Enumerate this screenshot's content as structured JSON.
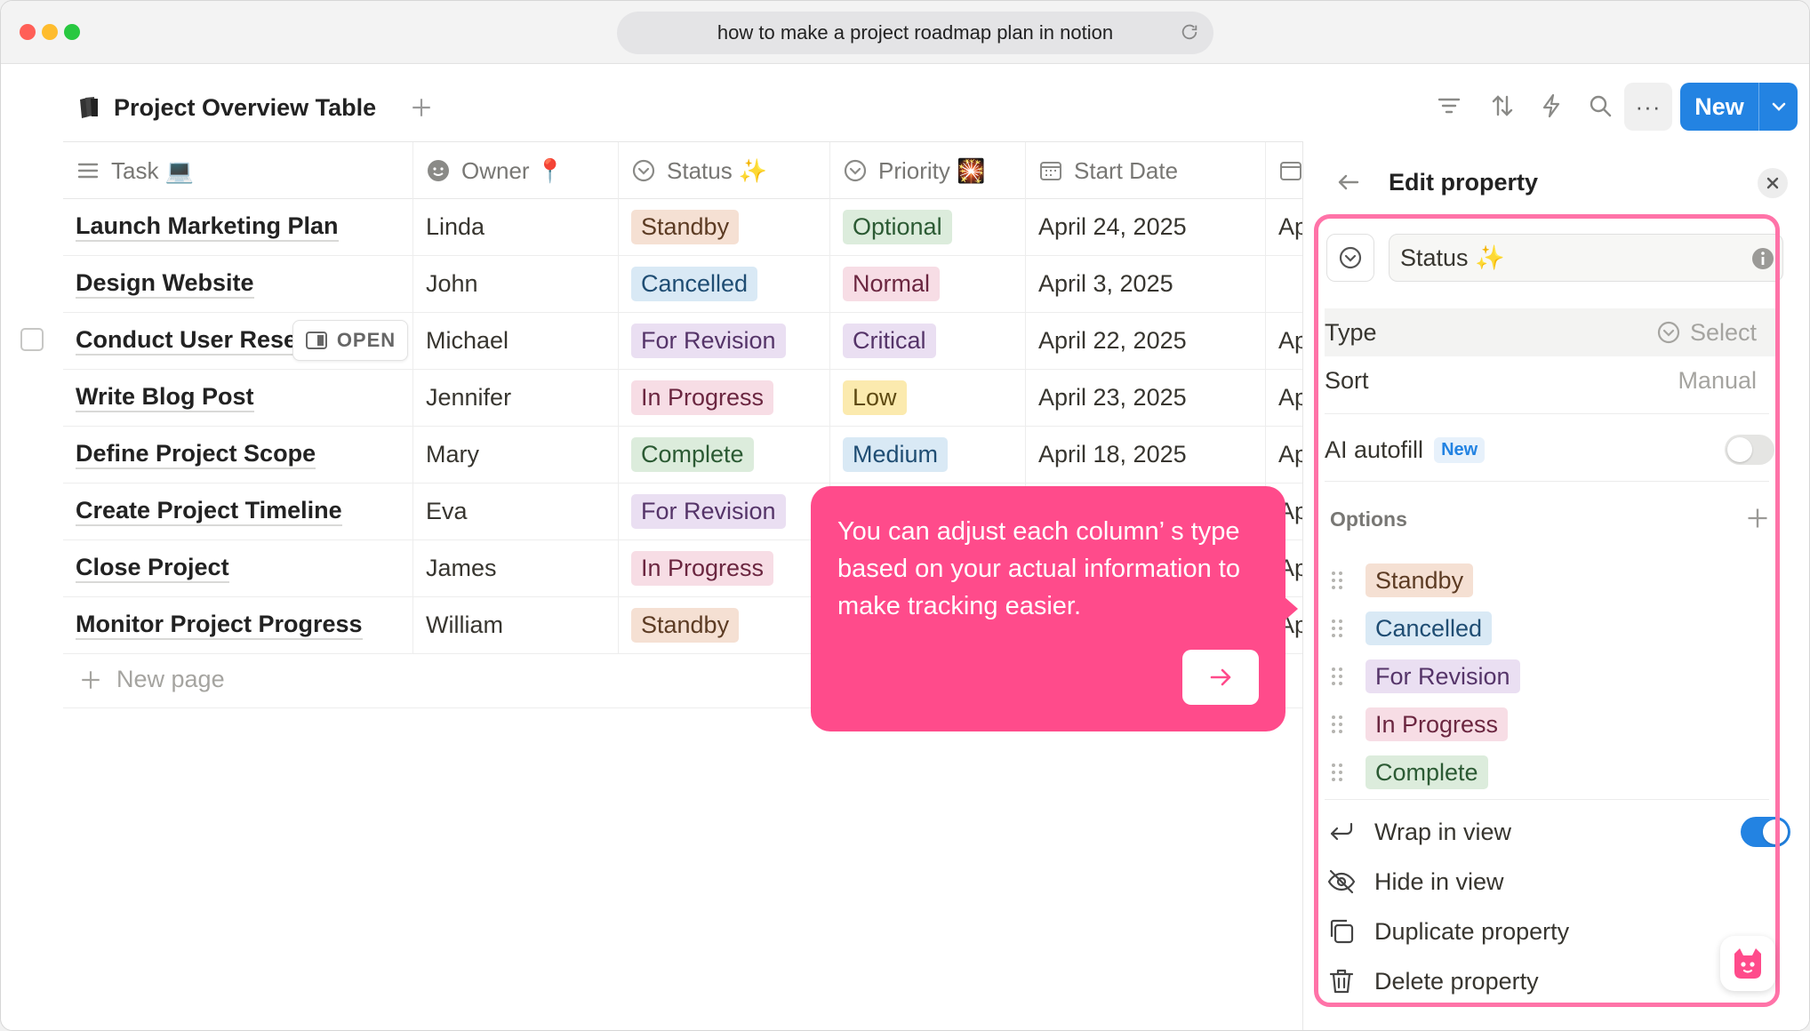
{
  "browser": {
    "url_text": "how to make a project roadmap plan in notion"
  },
  "toolbar": {
    "db_title": "Project Overview Table",
    "more_label": "···",
    "new_label": "New"
  },
  "table": {
    "columns": [
      {
        "label": "Task 💻"
      },
      {
        "label": "Owner 📍"
      },
      {
        "label": "Status ✨"
      },
      {
        "label": "Priority 🎇"
      },
      {
        "label": "Start Date"
      }
    ],
    "rows": [
      {
        "task": "Launch Marketing Plan",
        "owner": "Linda",
        "status": "Standby",
        "priority": "Optional",
        "start": "April 24, 2025",
        "next": "Ap"
      },
      {
        "task": "Design Website",
        "owner": "John",
        "status": "Cancelled",
        "priority": "Normal",
        "start": "April 3, 2025",
        "next": ""
      },
      {
        "task": "Conduct User Resea",
        "owner": "Michael",
        "status": "For Revision",
        "priority": "Critical",
        "start": "April 22, 2025",
        "next": "Ap"
      },
      {
        "task": "Write Blog Post",
        "owner": "Jennifer",
        "status": "In Progress",
        "priority": "Low",
        "start": "April 23, 2025",
        "next": "Ap"
      },
      {
        "task": "Define Project Scope",
        "owner": "Mary",
        "status": "Complete",
        "priority": "Medium",
        "start": "April 18, 2025",
        "next": "Ap"
      },
      {
        "task": "Create Project Timeline",
        "owner": "Eva",
        "status": "For Revision",
        "priority": "",
        "start": "",
        "next": "Ap"
      },
      {
        "task": "Close Project",
        "owner": "James",
        "status": "In Progress",
        "priority": "",
        "start": "",
        "next": "Ap"
      },
      {
        "task": "Monitor Project Progress",
        "owner": "William",
        "status": "Standby",
        "priority": "",
        "start": "",
        "next": "Ap"
      }
    ],
    "open_label": "OPEN",
    "new_page_label": "New page"
  },
  "tag_colors": {
    "Standby": {
      "bg": "#f5e0d3",
      "fg": "#5c3b23"
    },
    "Cancelled": {
      "bg": "#d9e9f5",
      "fg": "#1f4d73"
    },
    "For Revision": {
      "bg": "#eadff2",
      "fg": "#553469"
    },
    "In Progress": {
      "bg": "#f7dde5",
      "fg": "#6b2640"
    },
    "Complete": {
      "bg": "#dcecdc",
      "fg": "#2b5a33"
    },
    "Optional": {
      "bg": "#dcecdc",
      "fg": "#2b5a33"
    },
    "Normal": {
      "bg": "#f7dde5",
      "fg": "#6b2640"
    },
    "Critical": {
      "bg": "#eadff2",
      "fg": "#553469"
    },
    "Low": {
      "bg": "#fbeaae",
      "fg": "#5e4a12"
    },
    "Medium": {
      "bg": "#d9e9f5",
      "fg": "#1f4d73"
    }
  },
  "tooltip": {
    "text": "You can adjust each column’ s type based on your actual information to make tracking easier."
  },
  "panel": {
    "title": "Edit property",
    "property_name": "Status ✨",
    "type_label": "Type",
    "type_value": "Select",
    "sort_label": "Sort",
    "sort_value": "Manual",
    "ai_label": "AI autofill",
    "ai_badge": "New",
    "options_label": "Options",
    "options": [
      "Standby",
      "Cancelled",
      "For Revision",
      "In Progress",
      "Complete"
    ],
    "wrap_label": "Wrap in view",
    "hide_label": "Hide in view",
    "duplicate_label": "Duplicate property",
    "delete_label": "Delete property"
  },
  "colors": {
    "accent": "#2383e2",
    "tooltip": "#ff4b8b",
    "highlight": "#ff73a8"
  }
}
